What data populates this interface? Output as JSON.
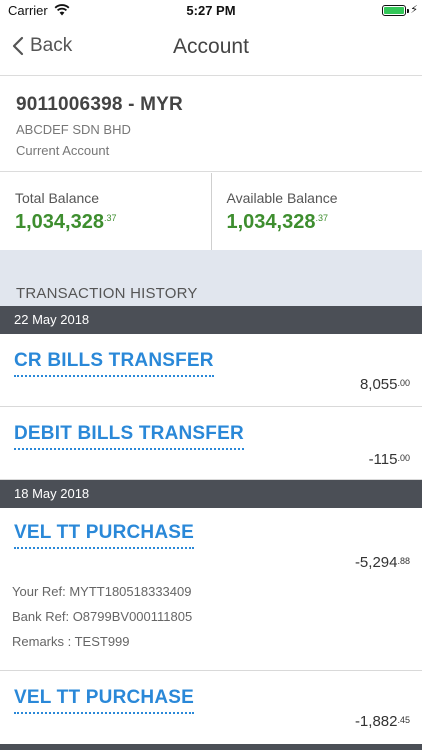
{
  "status_bar": {
    "carrier": "Carrier",
    "time": "5:27 PM",
    "wifi_icon": "wifi-icon",
    "battery_icon": "battery-icon",
    "charging_icon": "⚡",
    "battery_color": "#34c759"
  },
  "nav": {
    "back_label": "Back",
    "title": "Account"
  },
  "account": {
    "number": "9011006398 - MYR",
    "company": "ABCDEF SDN BHD",
    "type": "Current Account"
  },
  "balances": {
    "total": {
      "label": "Total Balance",
      "whole": "1,034,328",
      "cents": ".37"
    },
    "available": {
      "label": "Available Balance",
      "whole": "1,034,328",
      "cents": ".37"
    },
    "amount_color": "#3e8e2f"
  },
  "history": {
    "title": "TRANSACTION HISTORY",
    "groups": [
      {
        "date": "22 May 2018",
        "transactions": [
          {
            "title": "CR BILLS TRANSFER",
            "whole": "8,055",
            "cents": ".00"
          },
          {
            "title": "DEBIT BILLS TRANSFER",
            "whole": "-115",
            "cents": ".00"
          }
        ]
      },
      {
        "date": "18 May 2018",
        "transactions": [
          {
            "title": "VEL TT PURCHASE",
            "whole": "-5,294",
            "cents": ".88",
            "your_ref": "Your Ref: MYTT180518333409",
            "bank_ref": "Bank Ref: O8799BV000111805",
            "remarks": "Remarks : TEST999"
          },
          {
            "title": "VEL TT PURCHASE",
            "whole": "-1,882",
            "cents": ".45"
          }
        ]
      }
    ],
    "link_color": "#2a88d8",
    "date_bar_color": "#4b4f56"
  }
}
